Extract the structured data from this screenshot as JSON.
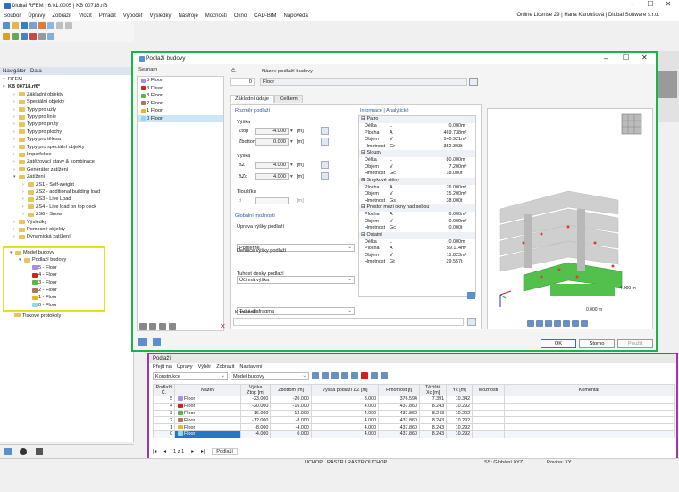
{
  "app": {
    "title": "Dlubal RFEM | 6.01.0005 | KB 00718.rf6",
    "license": "Online License 29 | Hana Karoušová | Dlubal Software s.r.o."
  },
  "menu": [
    "Soubor",
    "Úpravy",
    "Zobrazit",
    "Vložit",
    "Přiřadit",
    "Výpočet",
    "Výsledky",
    "Nástroje",
    "Možnosti",
    "Okno",
    "CAD-BIM",
    "Nápověda"
  ],
  "navigator": {
    "title": "Navigátor - Data",
    "root": "RFEM",
    "model": "KB 00718.rf6*",
    "items": [
      "Základní objekty",
      "Speciální objekty",
      "Typy pro uzly",
      "Typy pro linie",
      "Typy pro pruty",
      "Typy pro plochy",
      "Typy pro tělesa",
      "Typy pro speciální objekty",
      "Imperfekce",
      "Zatěžovací stavy & kombinace",
      "Generátor zatížení",
      "Zatížení"
    ],
    "loads": [
      "ZS1 - Self-weight",
      "ZS2 - additional building load",
      "ZS3 - Live Load",
      "ZS4 - Live load on top deck",
      "ZS6 - Snow"
    ],
    "after": [
      "Výsledky",
      "Pomocné objekty",
      "Dynamická zatížení"
    ],
    "building": "Model budovy",
    "floors_group": "Podlaží budovy",
    "floors": [
      {
        "label": "5 - Floor",
        "color": "#a98ee0"
      },
      {
        "label": "4 - Floor",
        "color": "#d92020"
      },
      {
        "label": "3 - Floor",
        "color": "#57b848"
      },
      {
        "label": "2 - Floor",
        "color": "#b0765a"
      },
      {
        "label": "1 - Floor",
        "color": "#e7b824"
      },
      {
        "label": "0 - Floor",
        "color": "#8fd8f2"
      }
    ],
    "last": "Tiskové protokoly"
  },
  "dialog": {
    "title": "Podlaží budovy",
    "list_header": "Seznam",
    "list": [
      {
        "label": "5  Floor",
        "color": "#a98ee0"
      },
      {
        "label": "4  Floor",
        "color": "#d92020"
      },
      {
        "label": "3  Floor",
        "color": "#57b848"
      },
      {
        "label": "2  Floor",
        "color": "#b0765a"
      },
      {
        "label": "1  Floor",
        "color": "#e7b824"
      },
      {
        "label": "0  Floor",
        "color": "#8fd8f2"
      }
    ],
    "no_label": "Č.",
    "no_value": "0",
    "name_label": "Název podlaží budovy",
    "name_value": "Floor",
    "tabs": [
      "Základní údaje",
      "Celkem"
    ],
    "dims_title": "Rozměr podlaží",
    "height_label": "Výška",
    "z_top_label": "Ztop",
    "z_top": "-4.000",
    "z_top_unit": "[m]",
    "z_bot_label": "Zbottom",
    "z_bot": "0.000",
    "z_bot_unit": "[m]",
    "height2_label": "Výška",
    "dz_label": "ΔZ",
    "dz": "4.000",
    "dz_unit": "[m]",
    "dzc_label": "ΔZc",
    "dzc": "4.000",
    "dzc_unit": "[m]",
    "thick_label": "Tloušťka",
    "thick_d": "d",
    "thick_unit": "[m]",
    "global_title": "Globální možnosti",
    "height_mod_label": "Úprava výšky podlaží",
    "height_mod": "Poměrné",
    "def_label": "Definice výšky podlaží",
    "def": "Účinná výška",
    "stiff_label": "Tuhost desky podlaží",
    "stiff": "Tuhá diafragma",
    "comment_label": "Komentář",
    "info_title": "Informace | Analytické",
    "info_groups": [
      {
        "name": "Patro",
        "rows": [
          [
            "Délka",
            "L",
            "0.000",
            "m"
          ],
          [
            "Plocha",
            "A",
            "469.738",
            "m²"
          ],
          [
            "Objem",
            "V",
            "140.921",
            "m³"
          ],
          [
            "Hmotnost",
            "Gr",
            "352.303",
            "t"
          ]
        ]
      },
      {
        "name": "Sloupy",
        "rows": [
          [
            "Délka",
            "L",
            "80.000",
            "m"
          ],
          [
            "Objem",
            "V",
            "7.200",
            "m³"
          ],
          [
            "Hmotnost",
            "Gc",
            "18.000",
            "t"
          ]
        ]
      },
      {
        "name": "Smykové stěny",
        "rows": [
          [
            "Plocha",
            "A",
            "76.000",
            "m²"
          ],
          [
            "Objem",
            "V",
            "15.200",
            "m³"
          ],
          [
            "Hmotnost",
            "Gs",
            "38.000",
            "t"
          ]
        ]
      },
      {
        "name": "Prostor mezi okny nad sebou",
        "rows": [
          [
            "Plocha",
            "A",
            "0.000",
            "m²"
          ],
          [
            "Objem",
            "V",
            "0.000",
            "m³"
          ],
          [
            "Hmotnost",
            "Gc",
            "0.000",
            "t"
          ]
        ]
      },
      {
        "name": "Ostatní",
        "rows": [
          [
            "Délka",
            "L",
            "0.000",
            "m"
          ],
          [
            "Plocha",
            "A",
            "59.114",
            "m²"
          ],
          [
            "Objem",
            "V",
            "11.823",
            "m³"
          ],
          [
            "Hmotnost",
            "Gt",
            "29.557",
            "t"
          ]
        ]
      }
    ],
    "label_4m": "-4.000 m",
    "label_0m": "0.000 m",
    "ok": "OK",
    "cancel": "Storno",
    "apply": "Použít"
  },
  "panel": {
    "title": "Podlaží",
    "menu": [
      "Přejít na",
      "Úpravy",
      "Výběr",
      "Zobrazit",
      "Nastavení"
    ],
    "combo1": "Konstrukce",
    "combo2": "Model budovy",
    "headers": {
      "no": "Podlaží Č.",
      "name": "Název",
      "height": "Výška",
      "ztop": "Ztop [m]",
      "zbot": "Zbottom [m]",
      "dz": "Výška podlaží ΔZ [m]",
      "mass": "Hmotnost [t]",
      "cog": "Těžiště",
      "xc": "Xc [m]",
      "yc": "Yc [m]",
      "opt": "Možnosti",
      "comment": "Komentář"
    },
    "rows": [
      {
        "no": "5",
        "name": "Floor",
        "color": "#a98ee0",
        "ztop": "-23.000",
        "zbot": "-20.000",
        "dz": "3.000",
        "mass": "376.594",
        "xc": "7.391",
        "yc": "10.342"
      },
      {
        "no": "4",
        "name": "Floor",
        "color": "#d92020",
        "ztop": "-20.000",
        "zbot": "-16.000",
        "dz": "4.000",
        "mass": "437.860",
        "xc": "8.243",
        "yc": "10.292"
      },
      {
        "no": "3",
        "name": "Floor",
        "color": "#57b848",
        "ztop": "-16.000",
        "zbot": "-12.000",
        "dz": "4.000",
        "mass": "437.860",
        "xc": "8.243",
        "yc": "10.292"
      },
      {
        "no": "2",
        "name": "Floor",
        "color": "#b0765a",
        "ztop": "-12.000",
        "zbot": "-8.000",
        "dz": "4.000",
        "mass": "437.860",
        "xc": "8.243",
        "yc": "10.292"
      },
      {
        "no": "1",
        "name": "Floor",
        "color": "#e7b824",
        "ztop": "-8.000",
        "zbot": "-4.000",
        "dz": "4.000",
        "mass": "437.860",
        "xc": "8.243",
        "yc": "10.292"
      },
      {
        "no": "0",
        "name": "Floor",
        "color": "#8fd8f2",
        "ztop": "-4.000",
        "zbot": "0.000",
        "dz": "4.000",
        "mass": "437.860",
        "xc": "8.243",
        "yc": "10.292"
      }
    ],
    "pager": "1 z 1",
    "sheet": "Podlaží"
  },
  "status": {
    "items": [
      "UCHOP",
      "RASTR",
      "LRASTR",
      "OUCHOP"
    ],
    "ss": "SS: Globální XYZ",
    "plane": "Rovina: XY"
  }
}
